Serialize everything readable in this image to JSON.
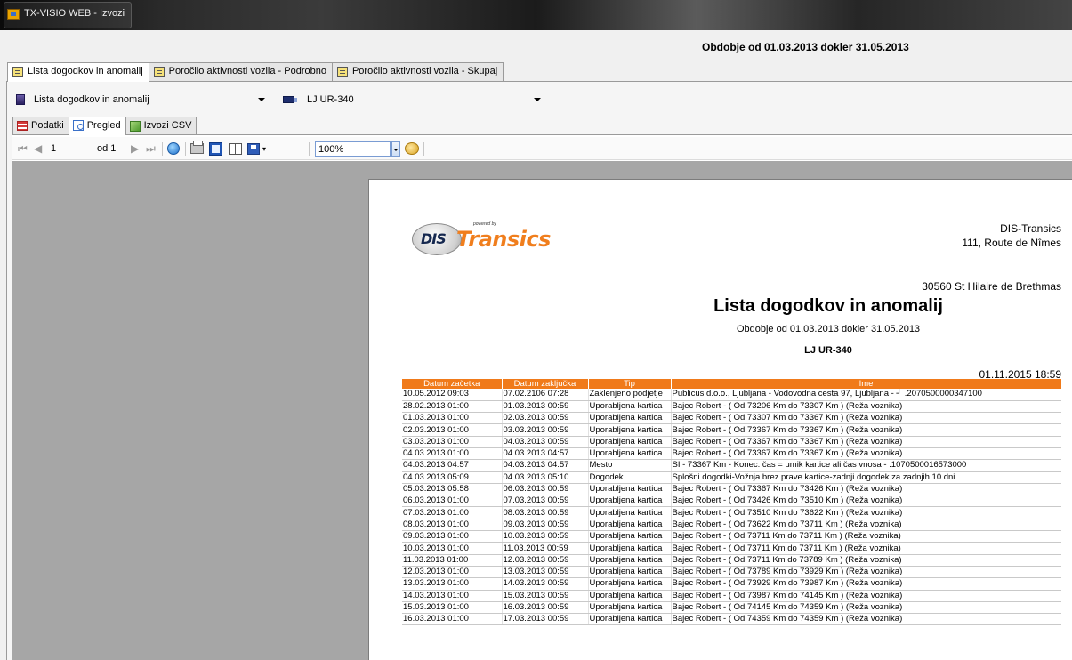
{
  "window": {
    "title": "TX-VISIO WEB - Izvozi"
  },
  "period_header": "Obdobje od 01.03.2013 dokler 31.05.2013",
  "main_tabs": [
    {
      "label": "Lista dogodkov in anomalij",
      "active": true
    },
    {
      "label": "Poročilo aktivnosti vozila - Podrobno",
      "active": false
    },
    {
      "label": "Poročilo aktivnosti vozila - Skupaj",
      "active": false
    }
  ],
  "selectors": {
    "report": "Lista dogodkov in anomalij",
    "vehicle": "LJ UR-340"
  },
  "sub_tabs": [
    {
      "label": "Podatki",
      "icon": "data-grid-icon",
      "active": false
    },
    {
      "label": "Pregled",
      "icon": "preview-icon",
      "active": true
    },
    {
      "label": "Izvozi CSV",
      "icon": "csv-export-icon",
      "active": false
    }
  ],
  "toolbar": {
    "page_current": "1",
    "page_of": "od 1",
    "zoom": "100%"
  },
  "report": {
    "logo_powered": "powered by",
    "logo_short": "DIS",
    "logo_name": "Transics",
    "company": {
      "name": "DIS-Transics",
      "street": "111, Route de Nîmes",
      "city": "30560 St Hilaire de Brethmas"
    },
    "title": "Lista dogodkov in anomalij",
    "period": "Obdobje od  01.03.2013 dokler 31.05.2013",
    "plate": "LJ UR-340",
    "generated": "01.11.2015 18:59",
    "columns": [
      "Datum začetka",
      "Datum zaključka",
      "Tip",
      "Ime"
    ],
    "rows": [
      [
        "10.05.2012 09:03",
        "07.02.2106 07:28",
        "Zaklenjeno podjetje",
        "Publicus d.o.o., Ljubljana - Vodovodna cesta 97, Ljubljana - ┘ .2070500000347100"
      ],
      [
        "28.02.2013 01:00",
        "01.03.2013 00:59",
        "Uporabljena kartica",
        "Bajec Robert - ( Od 73206 Km do 73307 Km ) (Reža voznika)"
      ],
      [
        "01.03.2013 01:00",
        "02.03.2013 00:59",
        "Uporabljena kartica",
        "Bajec Robert - ( Od 73307 Km do 73367 Km ) (Reža voznika)"
      ],
      [
        "02.03.2013 01:00",
        "03.03.2013 00:59",
        "Uporabljena kartica",
        "Bajec Robert - ( Od 73367 Km do 73367 Km ) (Reža voznika)"
      ],
      [
        "03.03.2013 01:00",
        "04.03.2013 00:59",
        "Uporabljena kartica",
        "Bajec Robert - ( Od 73367 Km do 73367 Km ) (Reža voznika)"
      ],
      [
        "04.03.2013 01:00",
        "04.03.2013 04:57",
        "Uporabljena kartica",
        "Bajec Robert - ( Od 73367 Km do 73367 Km ) (Reža voznika)"
      ],
      [
        "04.03.2013 04:57",
        "04.03.2013 04:57",
        "Mesto",
        "SI - 73367 Km - Konec: čas = umik kartice ali čas vnosa -   .1070500016573000"
      ],
      [
        "04.03.2013 05:09",
        "04.03.2013 05:10",
        "Dogodek",
        "Splošni dogodki-Vožnja brez prave kartice-zadnji dogodek za zadnjih 10 dni"
      ],
      [
        "05.03.2013 05:58",
        "06.03.2013 00:59",
        "Uporabljena kartica",
        "Bajec Robert - ( Od 73367 Km do 73426 Km ) (Reža voznika)"
      ],
      [
        "06.03.2013 01:00",
        "07.03.2013 00:59",
        "Uporabljena kartica",
        "Bajec Robert - ( Od 73426 Km do 73510 Km ) (Reža voznika)"
      ],
      [
        "07.03.2013 01:00",
        "08.03.2013 00:59",
        "Uporabljena kartica",
        "Bajec Robert - ( Od 73510 Km do 73622 Km ) (Reža voznika)"
      ],
      [
        "08.03.2013 01:00",
        "09.03.2013 00:59",
        "Uporabljena kartica",
        "Bajec Robert - ( Od 73622 Km do 73711 Km ) (Reža voznika)"
      ],
      [
        "09.03.2013 01:00",
        "10.03.2013 00:59",
        "Uporabljena kartica",
        "Bajec Robert - ( Od 73711 Km do 73711 Km ) (Reža voznika)"
      ],
      [
        "10.03.2013 01:00",
        "11.03.2013 00:59",
        "Uporabljena kartica",
        "Bajec Robert - ( Od 73711 Km do 73711 Km ) (Reža voznika)"
      ],
      [
        "11.03.2013 01:00",
        "12.03.2013 00:59",
        "Uporabljena kartica",
        "Bajec Robert - ( Od 73711 Km do 73789 Km ) (Reža voznika)"
      ],
      [
        "12.03.2013 01:00",
        "13.03.2013 00:59",
        "Uporabljena kartica",
        "Bajec Robert - ( Od 73789 Km do 73929 Km ) (Reža voznika)"
      ],
      [
        "13.03.2013 01:00",
        "14.03.2013 00:59",
        "Uporabljena kartica",
        "Bajec Robert - ( Od 73929 Km do 73987 Km ) (Reža voznika)"
      ],
      [
        "14.03.2013 01:00",
        "15.03.2013 00:59",
        "Uporabljena kartica",
        "Bajec Robert - ( Od 73987 Km do 74145 Km ) (Reža voznika)"
      ],
      [
        "15.03.2013 01:00",
        "16.03.2013 00:59",
        "Uporabljena kartica",
        "Bajec Robert - ( Od 74145 Km do 74359 Km ) (Reža voznika)"
      ],
      [
        "16.03.2013 01:00",
        "17.03.2013 00:59",
        "Uporabljena kartica",
        "Bajec Robert - ( Od 74359 Km do 74359 Km ) (Reža voznika)"
      ]
    ]
  },
  "colors": {
    "accent_orange": "#f07a1a",
    "logo_navy": "#15284f"
  }
}
